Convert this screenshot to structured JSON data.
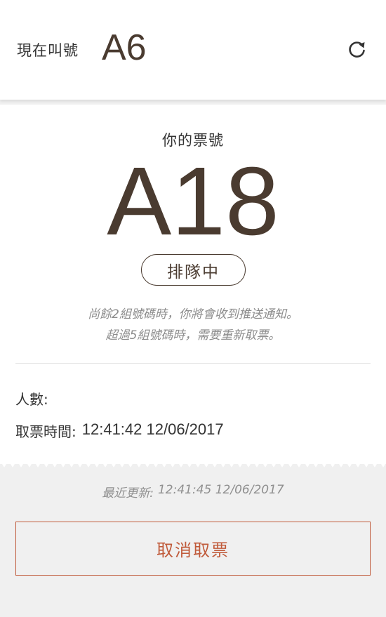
{
  "header": {
    "now_calling_label": "現在叫號",
    "now_calling_number": "A6",
    "refresh_icon": "refresh-icon"
  },
  "ticket": {
    "your_ticket_label": "你的票號",
    "ticket_number": "A18",
    "status": "排隊中",
    "notice_line1": "尚餘2組號碼時，你將會收到推送通知。",
    "notice_line2": "超過5組號碼時，需要重新取票。",
    "people_label": "人數:",
    "people_value": "",
    "ticket_time_label": "取票時間:",
    "ticket_time_value": "12:41:42 12/06/2017"
  },
  "footer": {
    "last_updated_label": "最近更新:",
    "last_updated_value": "12:41:45 12/06/2017",
    "cancel_button": "取消取票"
  },
  "colors": {
    "brown": "#4a3b30",
    "accent": "#c05a3a",
    "muted": "#8c8c8c",
    "background": "#f0f0f0"
  }
}
